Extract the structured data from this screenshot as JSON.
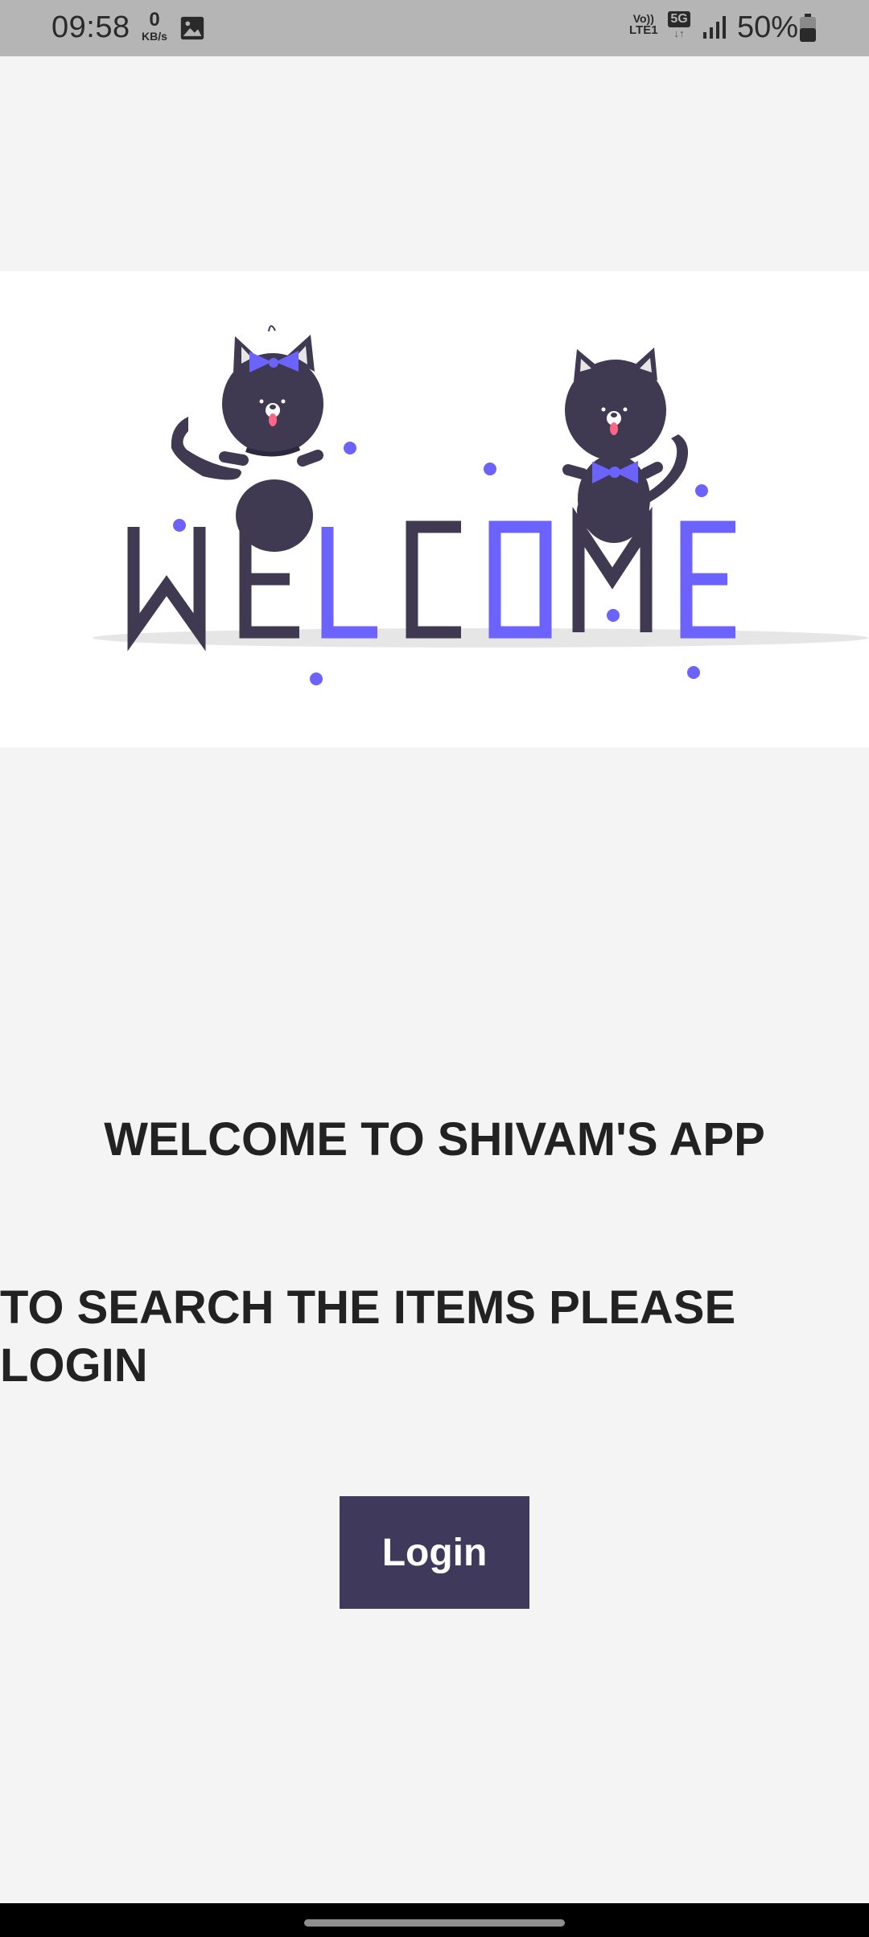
{
  "status_bar": {
    "time": "09:58",
    "net_speed_value": "0",
    "net_speed_unit": "KB/s",
    "network_top": "Vo))",
    "network_bottom": "LTE1",
    "network_type": "5G",
    "network_arrows": "↓↑",
    "battery_percent": "50%"
  },
  "banner": {
    "illustration_letters": [
      "W",
      "E",
      "L",
      "C",
      "O",
      "M",
      "E"
    ],
    "colors": {
      "dark": "#3f3a52",
      "accent": "#6c63ff",
      "shadow": "#e6e6e6"
    }
  },
  "main": {
    "welcome_text": "WELCOME TO SHIVAM'S APP",
    "instruction_text": "TO SEARCH THE ITEMS PLEASE LOGIN",
    "login_button_label": "Login",
    "button_color": "#3f3a5c"
  }
}
